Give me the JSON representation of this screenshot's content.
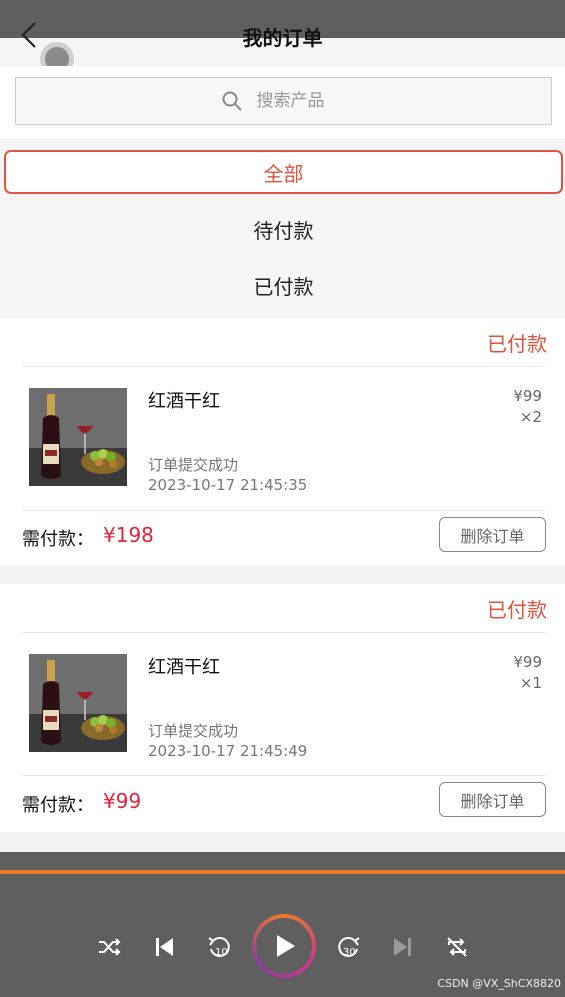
{
  "header": {
    "title": "我的订单"
  },
  "search": {
    "placeholder": "搜索产品"
  },
  "filters": [
    "全部",
    "待付款",
    "已付款"
  ],
  "orders": [
    {
      "status": "已付款",
      "product_name": "红酒干红",
      "price": "¥99",
      "quantity": "×2",
      "message": "订单提交成功",
      "time": "2023-10-17 21:45:35",
      "pay_label": "需付款：",
      "pay_amount": "¥198",
      "delete_label": "删除订单"
    },
    {
      "status": "已付款",
      "product_name": "红酒干红",
      "price": "¥99",
      "quantity": "×1",
      "message": "订单提交成功",
      "time": "2023-10-17 21:45:49",
      "pay_label": "需付款：",
      "pay_amount": "¥99",
      "delete_label": "删除订单"
    }
  ],
  "player": {
    "icons": [
      "shuffle-icon",
      "previous-icon",
      "rewind-10-icon",
      "play-icon",
      "forward-30-icon",
      "next-icon",
      "repeat-off-icon"
    ]
  },
  "watermark": "CSDN @VX_ShCX8820",
  "colors": {
    "accent": "#e0533f",
    "price": "#e0233a",
    "player_accent": "#f07a2c"
  }
}
